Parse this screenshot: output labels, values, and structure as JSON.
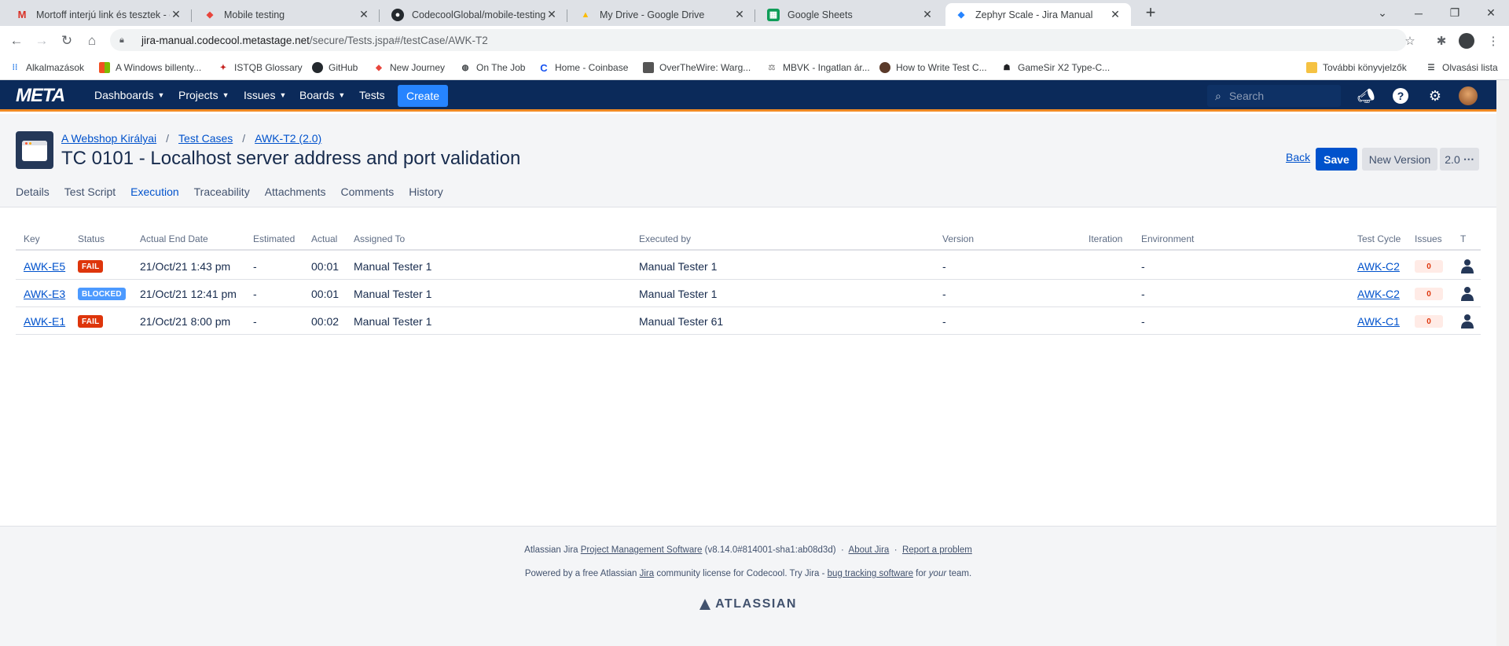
{
  "browser": {
    "tabs": [
      {
        "title": "Mortoff interjú link és tesztek - c",
        "favicon": "gmail-icon",
        "color": "#d93025"
      },
      {
        "title": "Mobile testing",
        "favicon": "codecool-icon",
        "color": "#e8453c"
      },
      {
        "title": "CodecoolGlobal/mobile-testing-",
        "favicon": "github-icon",
        "color": "#24292e"
      },
      {
        "title": "My Drive - Google Drive",
        "favicon": "google-drive-icon",
        "color": "#fbbc04"
      },
      {
        "title": "Google Sheets",
        "favicon": "google-sheets-icon",
        "color": "#0f9d58"
      },
      {
        "title": "Zephyr Scale - Jira Manual",
        "favicon": "zephyr-icon",
        "color": "#2684ff"
      }
    ],
    "url_host": "jira-manual.codecool.metastage.net",
    "url_path": "/secure/Tests.jspa#/testCase/AWK-T2",
    "bookmarks": [
      {
        "label": "Alkalmazások",
        "icon": "apps-grid-icon"
      },
      {
        "label": "A Windows billenty...",
        "icon": "windows-icon"
      },
      {
        "label": "ISTQB Glossary",
        "icon": "istqb-icon"
      },
      {
        "label": "GitHub",
        "icon": "github-icon"
      },
      {
        "label": "New Journey",
        "icon": "codecool-icon"
      },
      {
        "label": "On The Job",
        "icon": "globe-icon"
      },
      {
        "label": "Home - Coinbase",
        "icon": "coinbase-icon"
      },
      {
        "label": "OverTheWire: Warg...",
        "icon": "overthewire-icon"
      },
      {
        "label": "MBVK - Ingatlan ár...",
        "icon": "mbvk-icon"
      },
      {
        "label": "How to Write Test C...",
        "icon": "site-icon"
      },
      {
        "label": "GameSir X2 Type-C...",
        "icon": "gamesir-icon"
      }
    ],
    "other_bookmarks": "További könyvjelzők",
    "reading_list": "Olvasási lista"
  },
  "jira": {
    "logo": "META",
    "nav": [
      "Dashboards",
      "Projects",
      "Issues",
      "Boards",
      "Tests"
    ],
    "create": "Create",
    "search_placeholder": "Search"
  },
  "testcase": {
    "breadcrumbs": [
      "A Webshop Királyai",
      "Test Cases",
      "AWK-T2 (2.0)"
    ],
    "title": "TC 0101 - Localhost server address and port validation",
    "back": "Back",
    "save": "Save",
    "new_version": "New Version",
    "version": "2.0",
    "tabs": [
      "Details",
      "Test Script",
      "Execution",
      "Traceability",
      "Attachments",
      "Comments",
      "History"
    ],
    "active_tab": "Execution"
  },
  "executions": {
    "columns": [
      "Key",
      "Status",
      "Actual End Date",
      "Estimated",
      "Actual",
      "Assigned To",
      "Executed by",
      "Version",
      "Iteration",
      "Environment",
      "Test Cycle",
      "Issues",
      "T"
    ],
    "rows": [
      {
        "key": "AWK-E5",
        "status": "FAIL",
        "end_date": "21/Oct/21 1:43 pm",
        "estimated": "-",
        "actual": "00:01",
        "assigned": "Manual Tester 1",
        "executed_by": "Manual Tester 1",
        "version": "-",
        "environment": "-",
        "cycle": "AWK-C2",
        "issues": "0"
      },
      {
        "key": "AWK-E3",
        "status": "BLOCKED",
        "end_date": "21/Oct/21 12:41 pm",
        "estimated": "-",
        "actual": "00:01",
        "assigned": "Manual Tester 1",
        "executed_by": "Manual Tester 1",
        "version": "-",
        "environment": "-",
        "cycle": "AWK-C2",
        "issues": "0"
      },
      {
        "key": "AWK-E1",
        "status": "FAIL",
        "end_date": "21/Oct/21 8:00 pm",
        "estimated": "-",
        "actual": "00:02",
        "assigned": "Manual Tester 1",
        "executed_by": "Manual Tester 61",
        "version": "-",
        "environment": "-",
        "cycle": "AWK-C1",
        "issues": "0"
      }
    ]
  },
  "footer": {
    "l1_a": "Atlassian Jira",
    "l1_link": "Project Management Software",
    "l1_b": "(v8.14.0#814001-sha1:ab08d3d)",
    "about": "About Jira",
    "report": "Report a problem",
    "l2_a": "Powered by a free Atlassian",
    "l2_jira": "Jira",
    "l2_b": "community license for Codecool. Try Jira -",
    "l2_link": "bug tracking software",
    "l2_c": "for",
    "l2_your": "your",
    "l2_d": "team.",
    "brand": "ATLASSIAN"
  },
  "colors": {
    "jira_header": "#0b2a5a",
    "accent": "#0052cc",
    "fail": "#de350b",
    "blocked": "#4c9aff"
  }
}
